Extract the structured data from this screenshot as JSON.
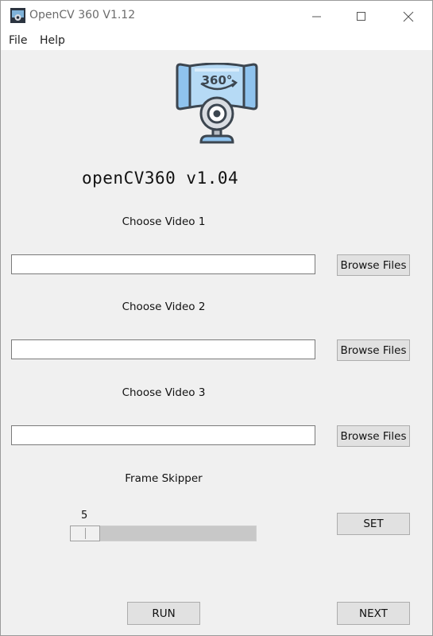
{
  "window": {
    "title": "OpenCV 360 V1.12",
    "app_icon": "webcam-app-icon"
  },
  "menu": {
    "items": [
      {
        "label": "File"
      },
      {
        "label": "Help"
      }
    ]
  },
  "logo": {
    "icon": "webcam-360-logo",
    "badge_text": "360°"
  },
  "heading": "openCV360 v1.04",
  "videos": [
    {
      "label": "Choose Video 1",
      "value": "",
      "browse_label": "Browse Files"
    },
    {
      "label": "Choose Video 2",
      "value": "",
      "browse_label": "Browse Files"
    },
    {
      "label": "Choose Video 3",
      "value": "",
      "browse_label": "Browse Files"
    }
  ],
  "frame_skipper": {
    "label": "Frame Skipper",
    "value": "5",
    "set_label": "SET"
  },
  "actions": {
    "run_label": "RUN",
    "next_label": "NEXT"
  },
  "colors": {
    "window_bg": "#f0f0f0",
    "logo_blue": "#8fc3ee",
    "logo_dark": "#3c4650"
  }
}
